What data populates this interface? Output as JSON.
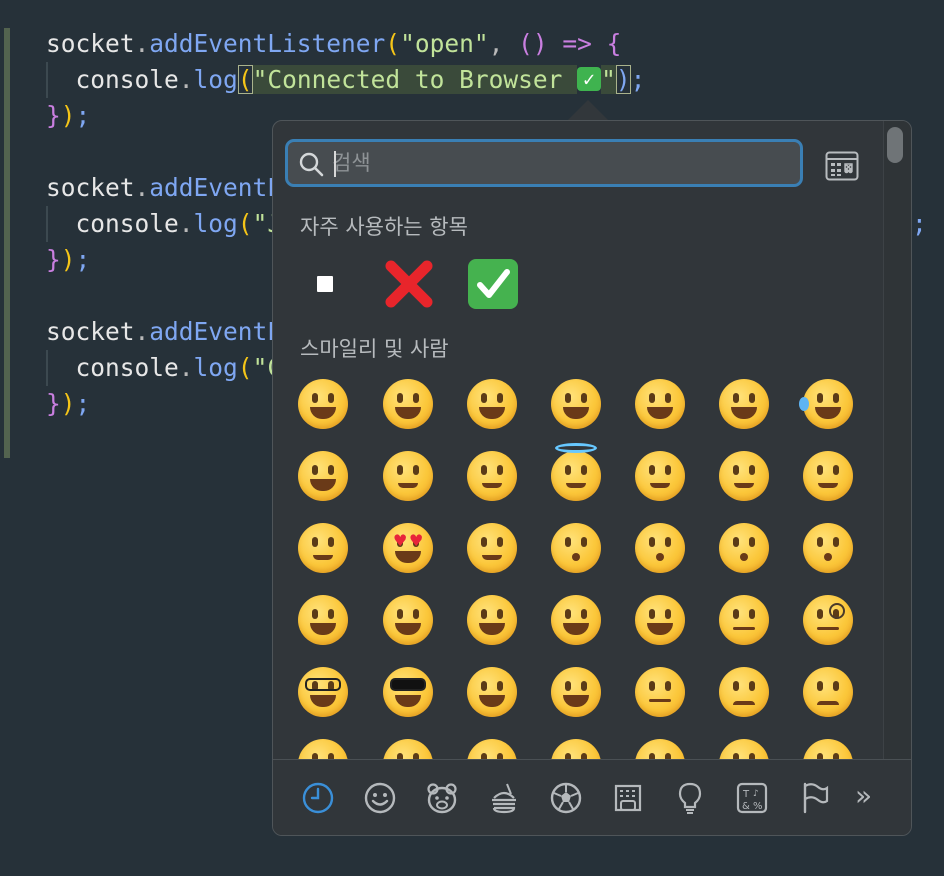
{
  "code": {
    "lines": [
      {
        "tokens": [
          {
            "t": "socket",
            "c": "tok-obj"
          },
          {
            "t": ".",
            "c": "tok-punc"
          },
          {
            "t": "addEventListener",
            "c": "tok-fn"
          },
          {
            "t": "(",
            "c": "tok-paren1"
          },
          {
            "t": "\"open\"",
            "c": "tok-str"
          },
          {
            "t": ", ",
            "c": "tok-punc"
          },
          {
            "t": "()",
            "c": "tok-paren2"
          },
          {
            "t": " ",
            "c": "tok-punc"
          },
          {
            "t": "=>",
            "c": "tok-kw"
          },
          {
            "t": " ",
            "c": "tok-punc"
          },
          {
            "t": "{",
            "c": "tok-brace"
          }
        ]
      },
      {
        "indent": true,
        "tokens": [
          {
            "t": "  console",
            "c": "tok-obj"
          },
          {
            "t": ".",
            "c": "tok-punc"
          },
          {
            "t": "log",
            "c": "tok-fn"
          },
          {
            "t": "(",
            "c": "tok-paren1 bracket-box"
          },
          {
            "t": "\"Connected to Browser ",
            "c": "tok-str tok-sel"
          },
          {
            "t": "✅",
            "c": "check"
          },
          {
            "t": "\"",
            "c": "tok-str tok-sel"
          },
          {
            "t": ")",
            "c": "tok-fn bracket-box"
          },
          {
            "t": ";",
            "c": "tok-fn"
          }
        ]
      },
      {
        "tokens": [
          {
            "t": "}",
            "c": "tok-brace"
          },
          {
            "t": ")",
            "c": "tok-paren1"
          },
          {
            "t": ";",
            "c": "tok-fn"
          }
        ]
      },
      {
        "tokens": []
      },
      {
        "tokens": [
          {
            "t": "socket",
            "c": "tok-obj"
          },
          {
            "t": ".",
            "c": "tok-punc"
          },
          {
            "t": "addEventL",
            "c": "tok-fn"
          }
        ]
      },
      {
        "indent": true,
        "tokens": [
          {
            "t": "  console",
            "c": "tok-obj"
          },
          {
            "t": ".",
            "c": "tok-punc"
          },
          {
            "t": "log",
            "c": "tok-fn"
          },
          {
            "t": "(",
            "c": "tok-paren1"
          },
          {
            "t": "\"J",
            "c": "tok-str"
          }
        ]
      },
      {
        "tokens": [
          {
            "t": "}",
            "c": "tok-brace"
          },
          {
            "t": ")",
            "c": "tok-paren1"
          },
          {
            "t": ";",
            "c": "tok-fn"
          }
        ]
      },
      {
        "tokens": []
      },
      {
        "tokens": [
          {
            "t": "socket",
            "c": "tok-obj"
          },
          {
            "t": ".",
            "c": "tok-punc"
          },
          {
            "t": "addEventL",
            "c": "tok-fn"
          }
        ]
      },
      {
        "indent": true,
        "tokens": [
          {
            "t": "  console",
            "c": "tok-obj"
          },
          {
            "t": ".",
            "c": "tok-punc"
          },
          {
            "t": "log",
            "c": "tok-fn"
          },
          {
            "t": "(",
            "c": "tok-paren1"
          },
          {
            "t": "\"C",
            "c": "tok-str"
          }
        ]
      },
      {
        "tokens": [
          {
            "t": "}",
            "c": "tok-brace"
          },
          {
            "t": ")",
            "c": "tok-paren1"
          },
          {
            "t": ";",
            "c": "tok-fn"
          }
        ]
      }
    ],
    "right_overflow": ";"
  },
  "emoji_picker": {
    "search": {
      "placeholder": "검색",
      "value": ""
    },
    "viewer_button_icon": "character-viewer-icon",
    "frequently_used": {
      "title": "자주 사용하는 항목",
      "items": [
        "▪️",
        "❌",
        "✅"
      ]
    },
    "smileys": {
      "title": "스마일리 및 사람",
      "rows": [
        [
          "😀",
          "😃",
          "😄",
          "😁",
          "😆",
          "😅",
          "😂"
        ],
        [
          "🤣",
          "☺️",
          "😊",
          "😇",
          "🙂",
          "🙃",
          "😉"
        ],
        [
          "😌",
          "😍",
          "🥰",
          "😘",
          "😗",
          "😙",
          "😚"
        ],
        [
          "😋",
          "😛",
          "😝",
          "😜",
          "🤪",
          "🤨",
          "🧐"
        ],
        [
          "🤓",
          "😎",
          "🤩",
          "🥳",
          "😏",
          "😒",
          "😞"
        ],
        [
          "😔",
          "😟",
          "😕",
          "🙁",
          "☹️",
          "😣",
          "😖"
        ]
      ]
    },
    "categories": [
      {
        "name": "clock-icon",
        "active": true
      },
      {
        "name": "smiley-icon",
        "active": false
      },
      {
        "name": "bear-icon",
        "active": false
      },
      {
        "name": "food-icon",
        "active": false
      },
      {
        "name": "soccer-ball-icon",
        "active": false
      },
      {
        "name": "building-icon",
        "active": false
      },
      {
        "name": "lightbulb-icon",
        "active": false
      },
      {
        "name": "symbols-icon",
        "active": false
      },
      {
        "name": "flag-icon",
        "active": false
      }
    ],
    "more_label": "»",
    "accent_color": "#3a8fd8"
  }
}
